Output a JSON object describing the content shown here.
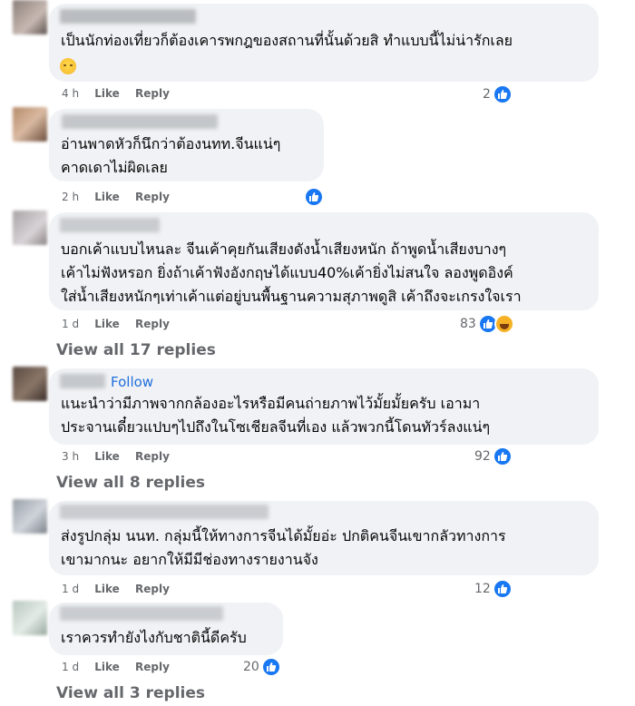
{
  "comments": [
    {
      "text_lines": [
        "เป็นนักท่องเที่ยวก็ต้องเคารพกฎของสถานที่นั้นด้วยสิ ทำแบบนี้ไม่น่ารักเลย"
      ],
      "has_emoji": true,
      "emoji_icon": "expressionless-face-icon",
      "time": "4 h",
      "like_label": "Like",
      "reply_label": "Reply",
      "reaction_count": "2",
      "reactions": [
        "like-icon"
      ]
    },
    {
      "text_lines": [
        "อ่านพาดหัวก็นึกว่าต้องนทท.จีนแน่ๆ",
        "คาดเดาไม่ผิดเลย"
      ],
      "time": "2 h",
      "like_label": "Like",
      "reply_label": "Reply",
      "reaction_count": "",
      "reactions": [
        "like-icon"
      ]
    },
    {
      "text_lines": [
        "บอกเค้าแบบไหนละ จีนเค้าคุยกันเสียงดังน้ำเสียงหนัก ถ้าพูดน้ำเสียงบางๆ",
        "เค้าไม่ฟังหรอก ยิ่งถ้าเค้าฟังอังกฤษได้แบบ40%เค้ายิ่งไม่สนใจ ลองพูดอิงค์",
        "ใส่น้ำเสียงหนักๆเท่าเค้าแต่อยู่บนพื้นฐานความสุภาพดูสิ เค้าถึงจะเกรงใจเรา"
      ],
      "time": "1 d",
      "like_label": "Like",
      "reply_label": "Reply",
      "reaction_count": "83",
      "reactions": [
        "like-icon",
        "haha-icon"
      ],
      "view_replies": "View all 17 replies"
    },
    {
      "follow_label": "Follow",
      "text_lines": [
        "แนะนำว่ามีภาพจากกล้องอะไรหรือมีคนถ่ายภาพไว้มั้ยมั้ยครับ เอามา",
        "ประจานเดี๋ยวแปบๆไปถึงในโซเชียลจีนที่เอง แล้วพวกนี้โดนทัวร์ลงแน่ๆ"
      ],
      "time": "3 h",
      "like_label": "Like",
      "reply_label": "Reply",
      "reaction_count": "92",
      "reactions": [
        "like-icon"
      ],
      "view_replies": "View all 8 replies"
    },
    {
      "text_lines": [
        "ส่งรูปกลุ่ม นนท. กลุ่มนี้ให้ทางการจีนได้มั้ยอ่ะ ปกติคนจีนเขากลัวทางการ",
        "เขามากนะ อยากให้มีมีช่องทางรายงานจัง"
      ],
      "time": "1 d",
      "like_label": "Like",
      "reply_label": "Reply",
      "reaction_count": "12",
      "reactions": [
        "like-icon"
      ]
    },
    {
      "text_lines": [
        "เราควรทำยังไงกับชาตินี้ดีครับ"
      ],
      "time": "1 d",
      "like_label": "Like",
      "reply_label": "Reply",
      "reaction_count": "20",
      "reactions": [
        "like-icon"
      ],
      "view_replies": "View all 3 replies"
    }
  ]
}
